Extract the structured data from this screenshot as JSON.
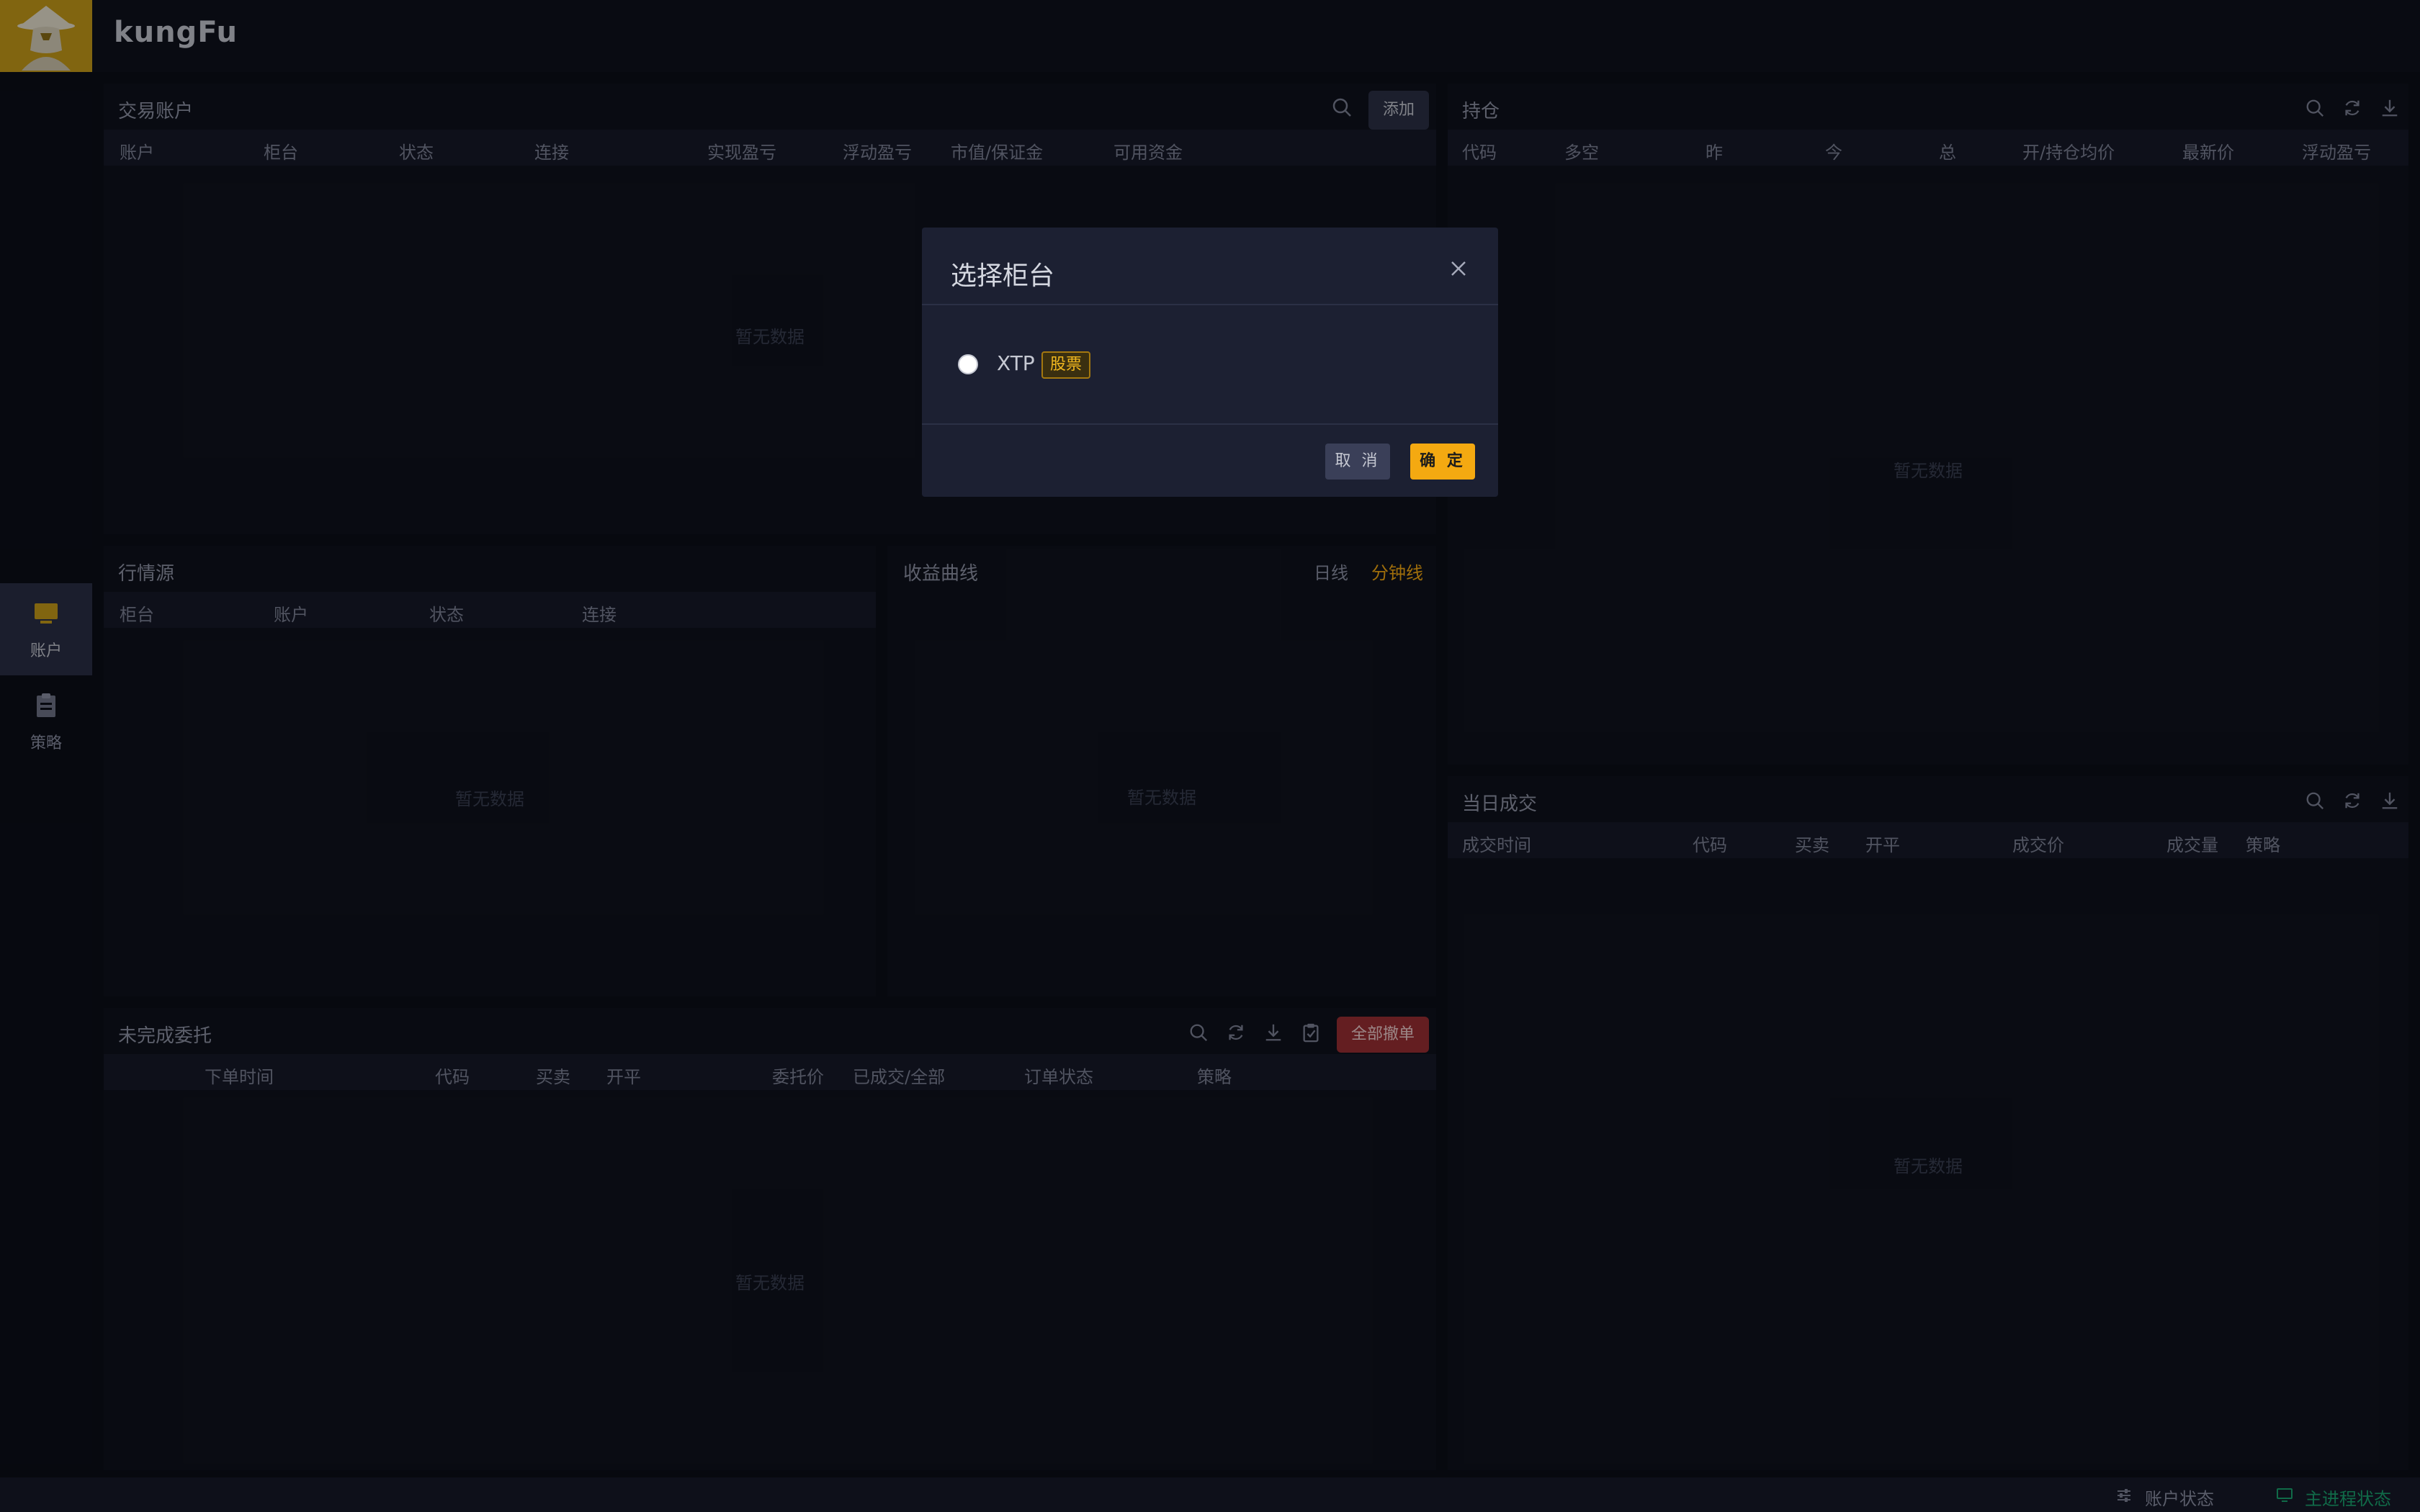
{
  "app": {
    "brand": "kungFu"
  },
  "sidebar": {
    "items": [
      {
        "label": "账户",
        "icon": "monitor-icon"
      },
      {
        "label": "策略",
        "icon": "clipboard-icon"
      }
    ]
  },
  "empty_text": "暂无数据",
  "trading_accounts": {
    "title": "交易账户",
    "add_label": "添加",
    "columns": [
      "账户",
      "柜台",
      "状态",
      "连接",
      "实现盈亏",
      "浮动盈亏",
      "市值/保证金",
      "可用资金"
    ]
  },
  "positions": {
    "title": "持仓",
    "columns": [
      "代码",
      "多空",
      "昨",
      "今",
      "总",
      "开/持仓均价",
      "最新价",
      "浮动盈亏"
    ]
  },
  "market_source": {
    "title": "行情源",
    "columns": [
      "柜台",
      "账户",
      "状态",
      "连接"
    ]
  },
  "pnl_curve": {
    "title": "收益曲线",
    "tabs": [
      {
        "label": "日线",
        "active": false
      },
      {
        "label": "分钟线",
        "active": true
      }
    ],
    "accent": "#f4a911"
  },
  "today_trades": {
    "title": "当日成交",
    "columns": [
      "成交时间",
      "代码",
      "买卖",
      "开平",
      "成交价",
      "成交量",
      "策略"
    ]
  },
  "pending_orders": {
    "title": "未完成委托",
    "cancel_all_label": "全部撤单",
    "columns": [
      "下单时间",
      "代码",
      "买卖",
      "开平",
      "委托价",
      "已成交/全部",
      "订单状态",
      "策略"
    ]
  },
  "modal": {
    "title": "选择柜台",
    "options": [
      {
        "name": "XTP",
        "tag": "股票",
        "selected": false
      }
    ],
    "cancel_label": "取 消",
    "ok_label": "确 定"
  },
  "status_bar": {
    "account_status": "账户状态",
    "main_process_status": "主进程状态",
    "status_color": "#1aa36f"
  }
}
